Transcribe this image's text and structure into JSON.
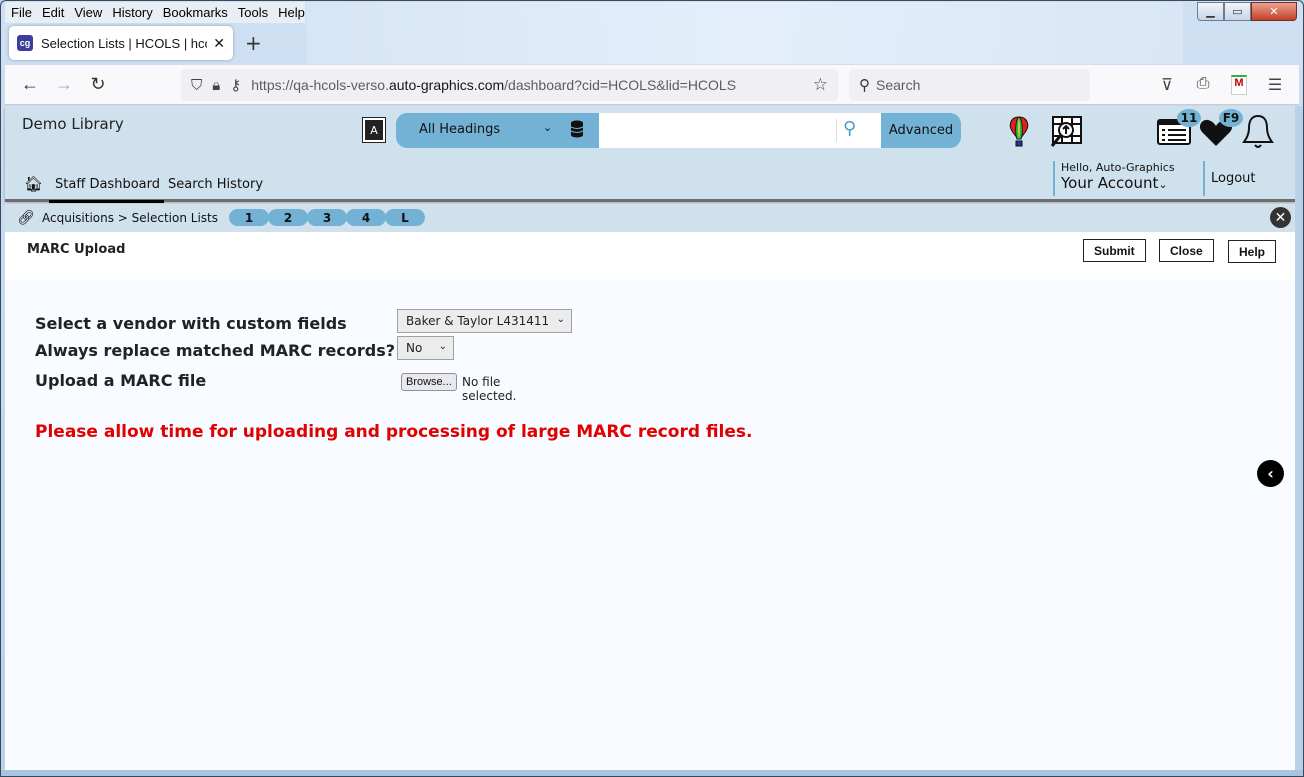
{
  "browser": {
    "menu": [
      "File",
      "Edit",
      "View",
      "History",
      "Bookmarks",
      "Tools",
      "Help"
    ],
    "tab_title": "Selection Lists | HCOLS | hcols |",
    "tab_favicon": "cg",
    "url_prefix": "https://qa-hcols-verso.",
    "url_domain": "auto-graphics.com",
    "url_suffix": "/dashboard?cid=HCOLS&lid=HCOLS",
    "search_placeholder": "Search"
  },
  "header": {
    "library_name": "Demo Library",
    "search_scope": "All Headings",
    "search_value": "",
    "advanced_label": "Advanced",
    "badges": {
      "lists_count": "11",
      "favorites": "F9"
    },
    "nav": [
      "Staff Dashboard",
      "Search History"
    ],
    "account_greeting": "Hello, Auto-Graphics",
    "account_label": "Your Account",
    "logout_label": "Logout"
  },
  "breadcrumb": {
    "path": "Acquisitions > Selection Lists",
    "pills": [
      "1",
      "2",
      "3",
      "4",
      "L"
    ]
  },
  "page": {
    "title": "MARC Upload",
    "buttons": {
      "submit": "Submit",
      "close": "Close",
      "help": "Help"
    },
    "form": {
      "vendor_label": "Select a vendor with custom fields",
      "vendor_value": "Baker & Taylor L431411",
      "replace_label": "Always replace matched MARC records?",
      "replace_value": "No",
      "upload_label": "Upload a MARC file",
      "browse_label": "Browse...",
      "file_status": "No file selected."
    },
    "warning": "Please allow time for uploading and processing of large MARC record files."
  },
  "colors": {
    "accent": "#74b2d5",
    "header_bg": "#cfe1ec",
    "warning": "#e00000"
  }
}
